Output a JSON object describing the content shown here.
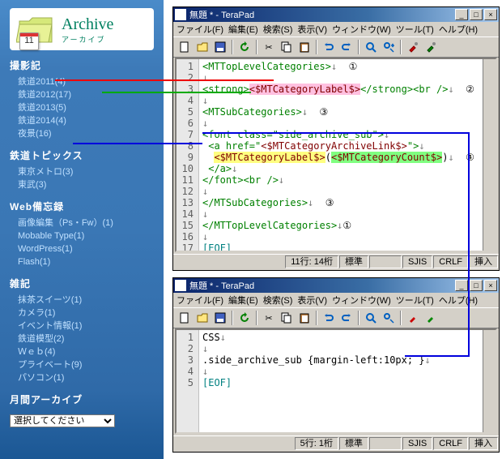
{
  "sidebar": {
    "archive_en": "Archive",
    "archive_jp": "アーカイブ",
    "calendar_day": "11",
    "sections": [
      {
        "title": "撮影記",
        "items": [
          "鉄道2011(4)",
          "鉄道2012(17)",
          "鉄道2013(5)",
          "鉄道2014(4)",
          "夜景(16)"
        ]
      },
      {
        "title": "鉄道トピックス",
        "items": [
          "東京メトロ(3)",
          "東武(3)"
        ]
      },
      {
        "title": "Web備忘録",
        "items": [
          "画像編集（Ps・Fw）(1)",
          "Mobable Type(1)",
          "WordPress(1)",
          "Flash(1)"
        ]
      },
      {
        "title": "雑記",
        "items": [
          "抹茶スイーツ(1)",
          "カメラ(1)",
          "イベント情報(1)",
          "鉄道模型(2)",
          "Ｗｅｂ(4)",
          "プライベート(9)",
          "パソコン(1)"
        ]
      }
    ],
    "monthly_title": "月間アーカイブ",
    "dropdown_placeholder": "選択してください"
  },
  "editor": {
    "title": "無題 * - TeraPad",
    "menus": [
      "ファイル(F)",
      "編集(E)",
      "検索(S)",
      "表示(V)",
      "ウィンドウ(W)",
      "ツール(T)",
      "ヘルプ(H)"
    ],
    "window_buttons": {
      "min": "_",
      "max": "□",
      "close": "×"
    }
  },
  "code1": {
    "lines": 17,
    "eof": "[EOF]",
    "l1_tag": "<MTTopLevelCategories>",
    "c1": "①",
    "l3_open": "<strong>",
    "l3_mt": "<$MTCategoryLabel$>",
    "l3_close": "</strong><br />",
    "c2": "②",
    "l5_tag": "<MTSubCategories>",
    "c3": "③",
    "l7_tag": "<font class=\"side_archive_sub\">",
    "l8_a": " <a href=\"",
    "l8_mt": "<$MTCategoryArchiveLink$>",
    "l8_b": "\">",
    "l9_sp": "  ",
    "l9_mt1": "<$MTCategoryLabel$>",
    "l9_p1": "(",
    "l9_mt2": "<$MTCategoryCount$>",
    "l9_p2": ")",
    "c4": "④",
    "l10": " </a>",
    "l11": "</font><br />",
    "l13": "</MTSubCategories>",
    "l15": "</MTTopLevelCategories>"
  },
  "status1": {
    "pos": "11行: 14桁",
    "mode": "標準",
    "enc": "SJIS",
    "crlf": "CRLF",
    "ins": "挿入"
  },
  "code2": {
    "lines": 5,
    "l1": "CSS",
    "l3": ".side_archive_sub {margin-left:10px; }",
    "eof": "[EOF]"
  },
  "status2": {
    "pos": "5行: 1桁",
    "mode": "標準",
    "enc": "SJIS",
    "crlf": "CRLF",
    "ins": "挿入"
  }
}
